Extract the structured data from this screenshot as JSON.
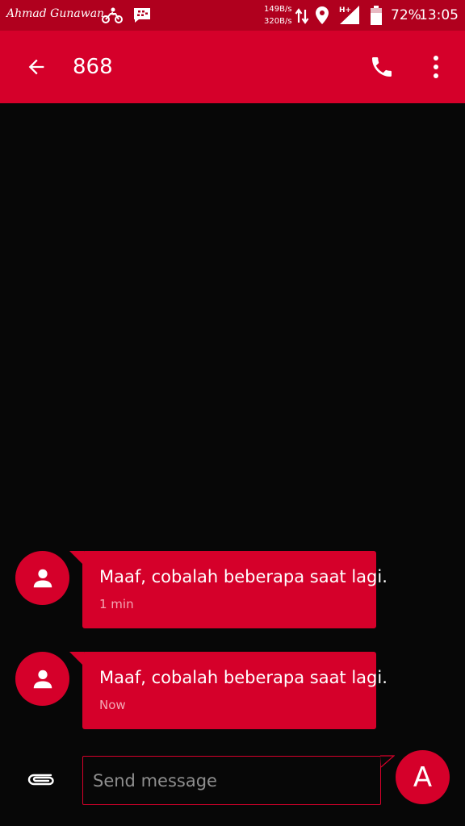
{
  "status_bar": {
    "carrier": "Ahmad Gunawan",
    "down_rate": "149B/s",
    "up_rate": "320B/s",
    "battery_percent": "72%",
    "time": "13:05",
    "icons": [
      "motorcycle-icon",
      "bbm-icon",
      "data-arrows-icon",
      "location-icon",
      "signal-hplus-icon",
      "battery-icon"
    ]
  },
  "toolbar": {
    "title": "868",
    "icons": {
      "back": "arrow-back-icon",
      "call": "phone-icon",
      "more": "more-vertical-icon"
    }
  },
  "messages": [
    {
      "text": "Maaf, cobalah beberapa saat lagi.",
      "time": "1 min"
    },
    {
      "text": "Maaf, cobalah beberapa saat lagi.",
      "time": "Now"
    }
  ],
  "compose": {
    "placeholder": "Send message",
    "value": "",
    "send_label": "A"
  },
  "colors": {
    "status_bar": "#b0001e",
    "accent": "#d5002a",
    "background": "#070707",
    "timestamp": "#f3a6b4",
    "placeholder": "#8e8e8e"
  }
}
